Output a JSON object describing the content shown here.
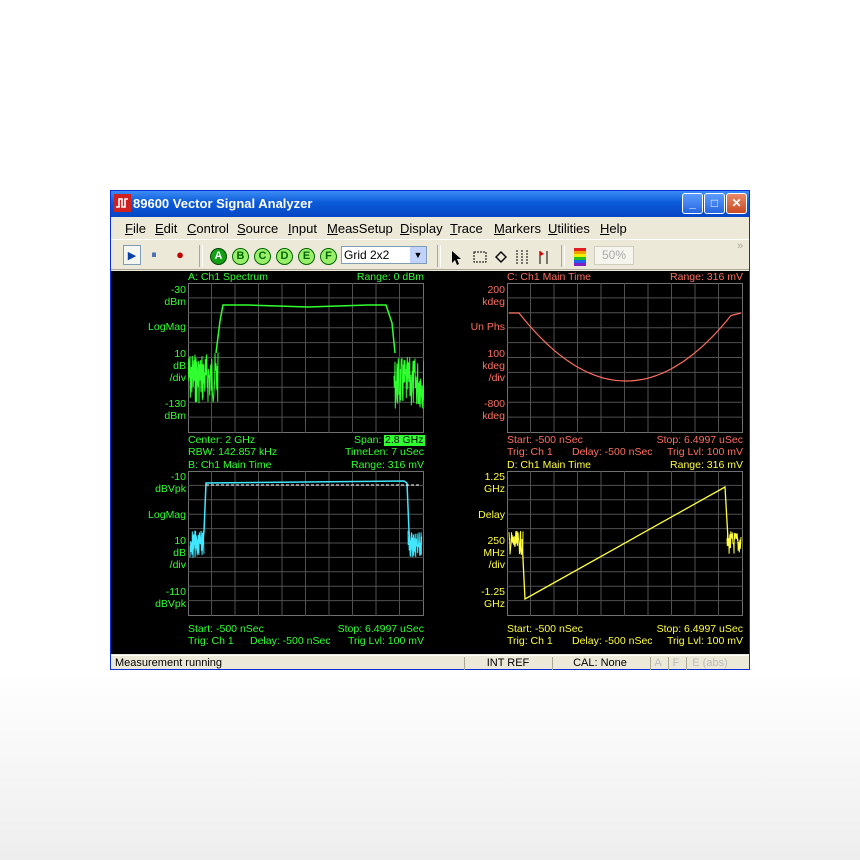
{
  "window": {
    "title": "89600 Vector Signal Analyzer",
    "minimize": "_",
    "maximize": "□",
    "close": "✕"
  },
  "menu": [
    "File",
    "Edit",
    "Control",
    "Source",
    "Input",
    "MeasSetup",
    "Display",
    "Trace",
    "Markers",
    "Utilities",
    "Help"
  ],
  "toolbar": {
    "play": "▶",
    "pause": "⏸",
    "record": "●",
    "traces": [
      "A",
      "B",
      "C",
      "D",
      "E",
      "F"
    ],
    "layout_select": "Grid 2x2",
    "percent": "50%",
    "overflow": "»"
  },
  "panels": {
    "a": {
      "title": "A: Ch1 Spectrum",
      "range": "Range: 0 dBm",
      "y_top": "-30",
      "y_top_unit": "dBm",
      "scale_type": "LogMag",
      "div_value": "10",
      "div_unit": "dB",
      "div_label": "/div",
      "y_bottom": "-130",
      "y_bottom_unit": "dBm",
      "footer_l1": "Center: 2 GHz",
      "footer_r1_label": "Span:",
      "footer_r1_value": "2.8 GHz",
      "footer_l2": "RBW: 142.857 kHz",
      "footer_r2": "TimeLen: 7 uSec",
      "color": "#30ff30"
    },
    "b": {
      "title": "B: Ch1 Main Time",
      "range": "Range: 316 mV",
      "y_top": "-10",
      "y_top_unit": "dBVpk",
      "scale_type": "LogMag",
      "div_value": "10",
      "div_unit": "dB",
      "div_label": "/div",
      "y_bottom": "-110",
      "y_bottom_unit": "dBVpk",
      "footer_l1": "Start: -500 nSec",
      "footer_r1": "Stop: 6.4997 uSec",
      "footer_l2": "Trig: Ch 1",
      "footer_m2": "Delay: -500 nSec",
      "footer_r2": "Trig Lvl: 100 mV",
      "color": "#40e8ff"
    },
    "c": {
      "title": "C: Ch1 Main Time",
      "range": "Range: 316 mV",
      "y_top": "200",
      "y_top_unit": "kdeg",
      "scale_type": "Un Phs",
      "div_value": "100",
      "div_unit": "kdeg",
      "div_label": "/div",
      "y_bottom": "-800",
      "y_bottom_unit": "kdeg",
      "footer_l1": "Start: -500 nSec",
      "footer_r1": "Stop: 6.4997 uSec",
      "footer_l2": "Trig: Ch 1",
      "footer_m2": "Delay: -500 nSec",
      "footer_r2": "Trig Lvl: 100 mV",
      "color": "#ff7060"
    },
    "d": {
      "title": "D: Ch1 Main Time",
      "range": "Range: 316 mV",
      "y_top": "1.25",
      "y_top_unit": "GHz",
      "scale_type": "Delay",
      "div_value": "250",
      "div_unit": "MHz",
      "div_label": "/div",
      "y_bottom": "-1.25",
      "y_bottom_unit": "GHz",
      "footer_l1": "Start: -500 nSec",
      "footer_r1": "Stop: 6.4997 uSec",
      "footer_l2": "Trig: Ch 1",
      "footer_m2": "Delay: -500 nSec",
      "footer_r2": "Trig Lvl: 100 mV",
      "color": "#ffff40"
    }
  },
  "status": {
    "message": "Measurement running",
    "ref": "INT REF",
    "cal": "CAL: None",
    "ind_a": "A",
    "ind_f": "F",
    "ind_e": "E (abs)"
  }
}
